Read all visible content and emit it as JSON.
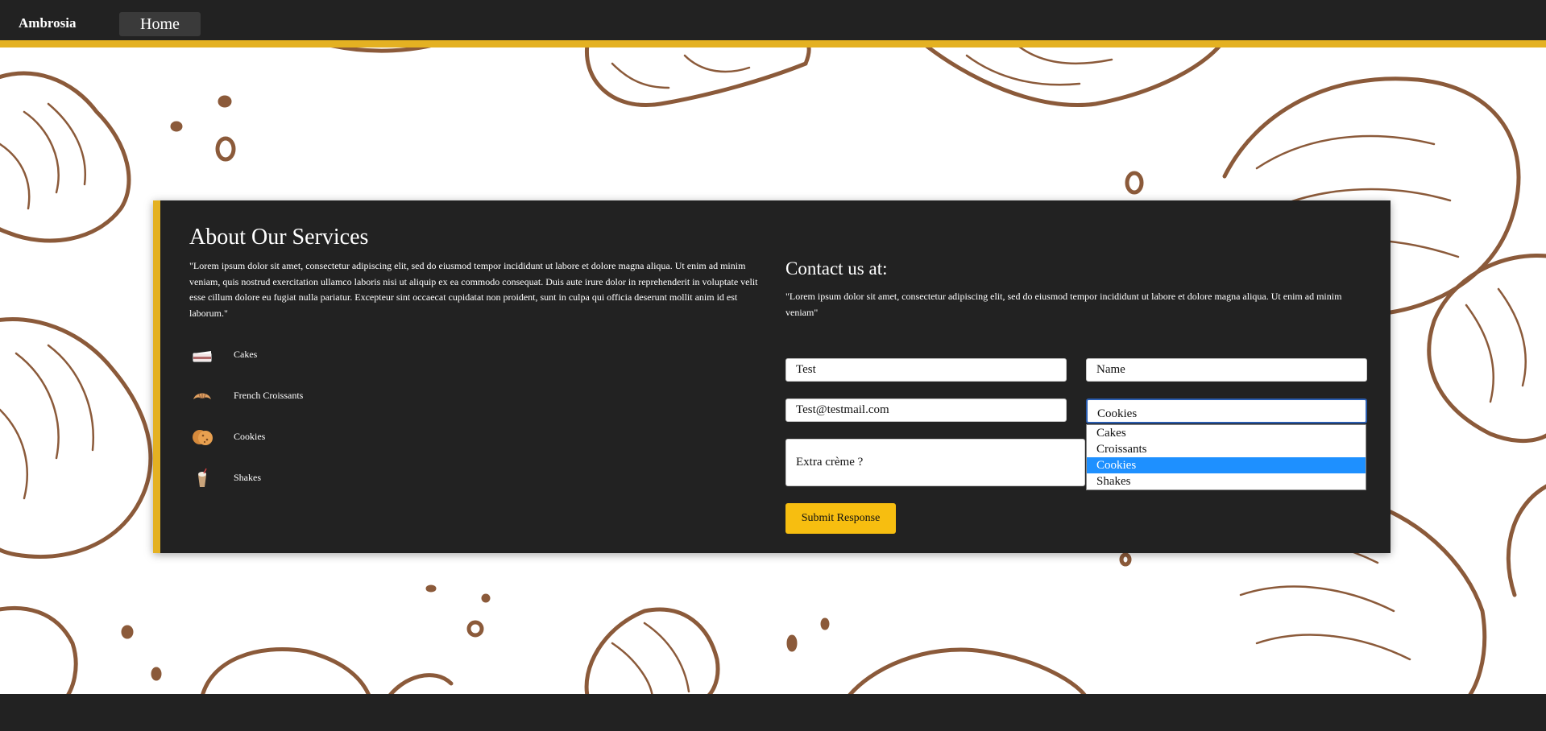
{
  "nav": {
    "brand": "Ambrosia",
    "home": "Home"
  },
  "about": {
    "title": "About Our Services",
    "text": "\"Lorem ipsum dolor sit amet, consectetur adipiscing elit, sed do eiusmod tempor incididunt ut labore et dolore magna aliqua. Ut enim ad minim veniam, quis nostrud exercitation ullamco laboris nisi ut aliquip ex ea commodo consequat. Duis aute irure dolor in reprehenderit in voluptate velit esse cillum dolore eu fugiat nulla pariatur. Excepteur sint occaecat cupidatat non proident, sunt in culpa qui officia deserunt mollit anim id est laborum.\"",
    "services": [
      {
        "label": "Cakes",
        "icon": "cake-icon"
      },
      {
        "label": "French Croissants",
        "icon": "croissant-icon"
      },
      {
        "label": "Cookies",
        "icon": "cookie-icon"
      },
      {
        "label": "Shakes",
        "icon": "shake-icon"
      }
    ]
  },
  "contact": {
    "title": "Contact us at:",
    "text": "\"Lorem ipsum dolor sit amet, consectetur adipiscing elit, sed do eiusmod tempor incididunt ut labore et dolore magna aliqua. Ut enim ad minim veniam\"",
    "form": {
      "field1": "Test",
      "name": "Name",
      "email": "Test@testmail.com",
      "product": "Cookies",
      "extra": "Extra crème ?",
      "options": [
        "Cakes",
        "Croissants",
        "Cookies",
        "Shakes"
      ],
      "selected_option": "Cookies",
      "submit": "Submit Response"
    }
  },
  "colors": {
    "nav_bg": "#222222",
    "accent": "#e4b122",
    "button": "#f7be10",
    "illustration": "#8b5a3a",
    "select_highlight": "#1e90ff"
  }
}
